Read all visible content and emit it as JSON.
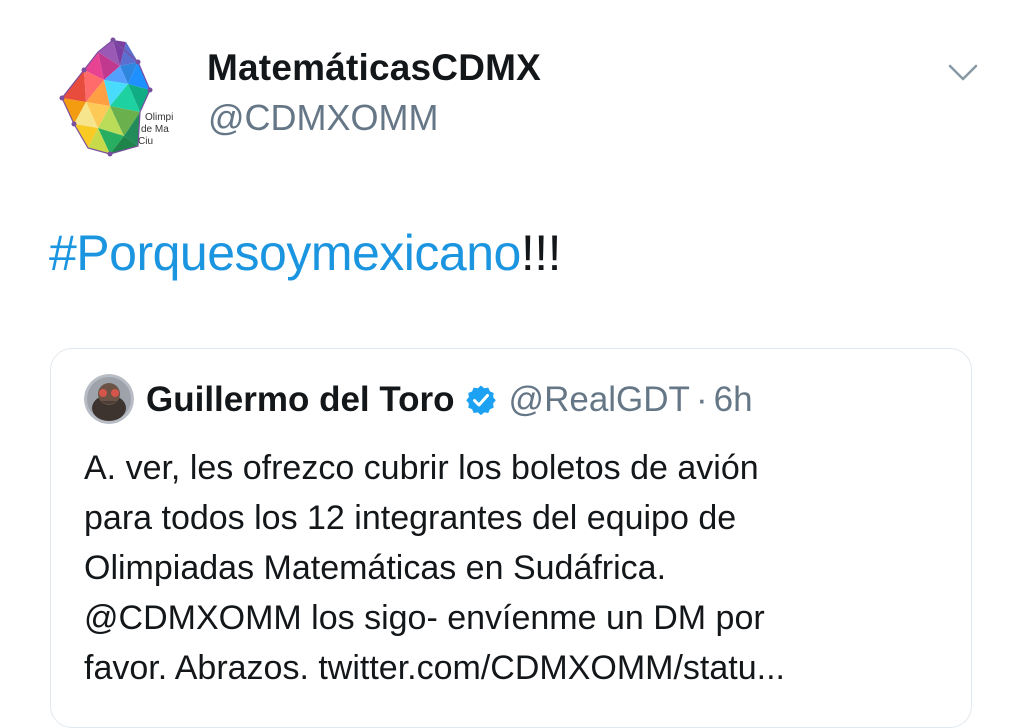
{
  "tweet": {
    "display_name": "MatemáticasCDMX",
    "handle": "@CDMXOMM",
    "text_hashtag": "#Porquesoymexicano",
    "text_rest": "!!!",
    "avatar_logo_text": [
      "Olimpi",
      "de Ma",
      "Ciu"
    ]
  },
  "quoted_tweet": {
    "display_name": "Guillermo del Toro",
    "handle": "@RealGDT",
    "separator": "·",
    "time": "6h",
    "body_lines": [
      "A. ver, les ofrezco cubrir los boletos de avión",
      "para todos los 12 integrantes del equipo de",
      "Olimpiadas Matemáticas en Sudáfrica.",
      "@CDMXOMM los sigo-  envíenme un DM por",
      "favor. Abrazos. twitter.com/CDMXOMM/statu..."
    ]
  },
  "icons": {
    "menu": "chevron-down-icon",
    "verified": "verified-badge-icon"
  },
  "colors": {
    "link_blue": "#1b95e0",
    "verified_blue": "#1da1f2",
    "secondary_text": "#657786",
    "border": "#e1e8ed"
  }
}
